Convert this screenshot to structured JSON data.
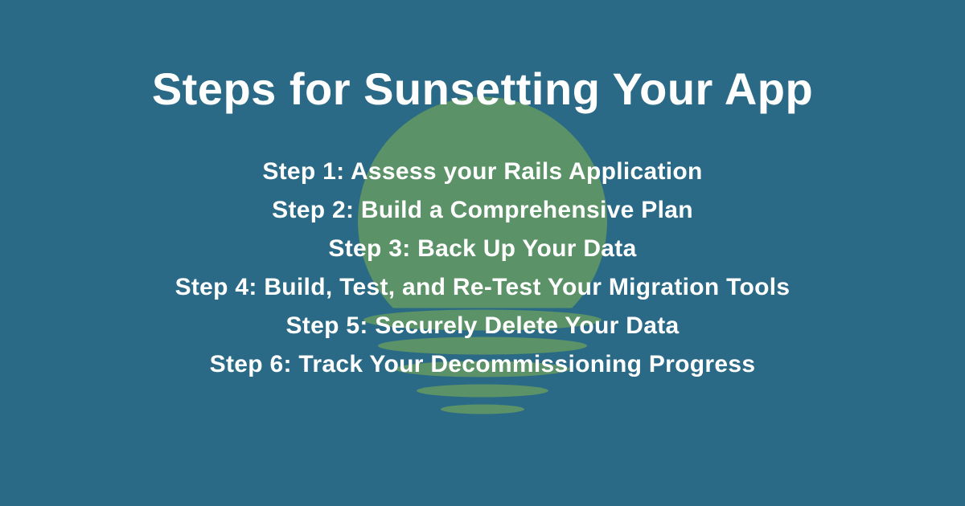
{
  "title": "Steps for Sunsetting Your App",
  "steps": [
    "Step 1: Assess your Rails Application",
    "Step 2: Build a Comprehensive Plan",
    "Step 3: Back Up Your Data",
    "Step 4: Build, Test, and Re-Test Your Migration Tools",
    "Step 5: Securely Delete Your Data",
    "Step 6: Track Your Decommissioning Progress"
  ],
  "colors": {
    "background": "#2b6a86",
    "sun": "#5b9267",
    "text": "#ffffff"
  }
}
